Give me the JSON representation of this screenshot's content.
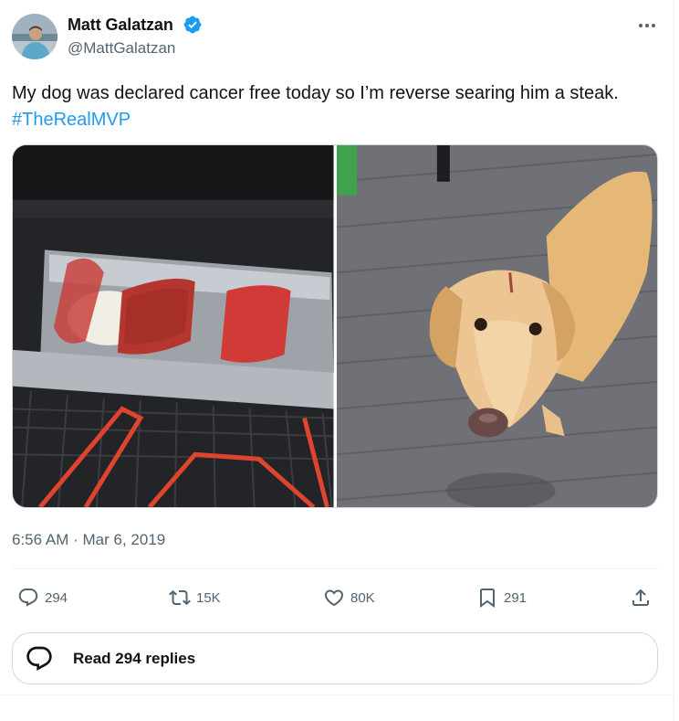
{
  "author": {
    "name": "Matt Galatzan",
    "handle": "@MattGalatzan",
    "verified": true,
    "verified_color": "#1d9bf0"
  },
  "tweet": {
    "text": "My dog was declared cancer free today so I’m reverse searing him a steak.",
    "hashtag": "#TheRealMVP",
    "hashtag_color": "#1d9bf0"
  },
  "media": [
    {
      "subject": "steaks-in-oven"
    },
    {
      "subject": "golden-retriever"
    }
  ],
  "meta": {
    "time": "6:56 AM",
    "separator": "·",
    "date": "Mar 6, 2019"
  },
  "actions": {
    "replies": "294",
    "retweets": "15K",
    "likes": "80K",
    "bookmarks": "291"
  },
  "icons": {
    "more": "more-horizontal-icon",
    "reply": "reply-icon",
    "retweet": "retweet-icon",
    "like": "heart-icon",
    "bookmark": "bookmark-icon",
    "share": "share-icon",
    "read_replies": "chat-bubble-icon"
  },
  "read_replies_label": "Read 294 replies",
  "colors": {
    "text_primary": "#0f1419",
    "text_secondary": "#536471",
    "border": "#cfd9de",
    "accent": "#1d9bf0"
  }
}
